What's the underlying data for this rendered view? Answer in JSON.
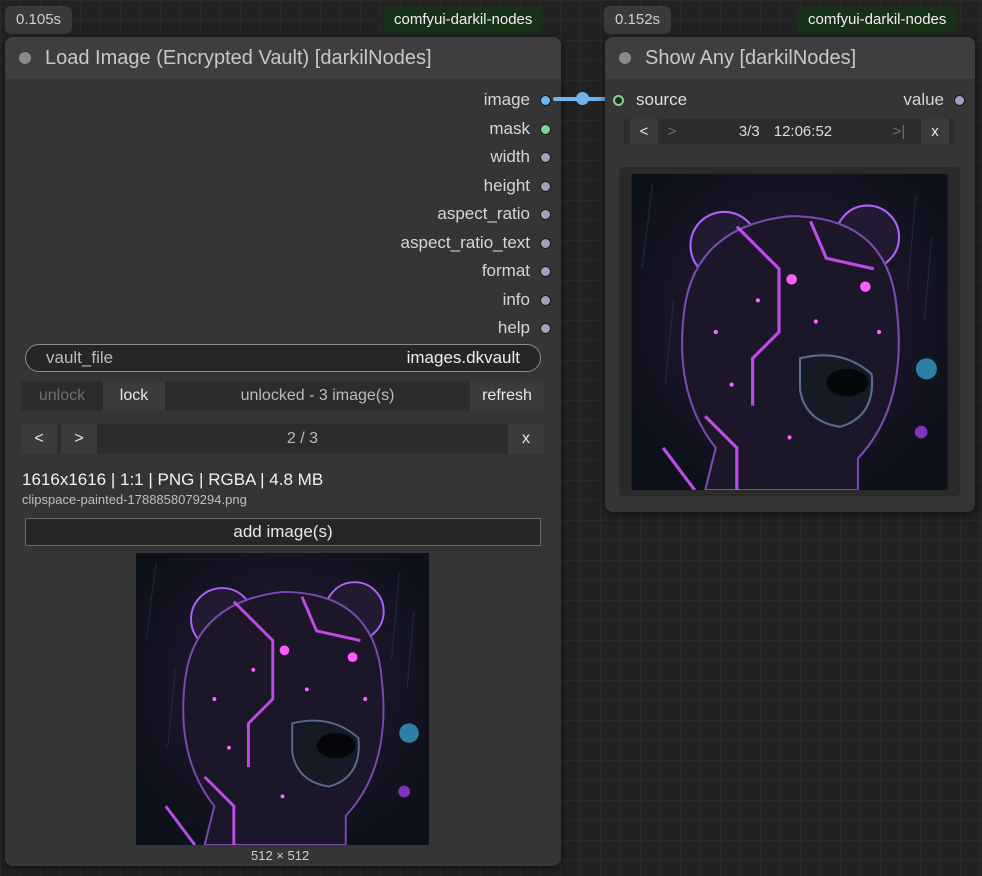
{
  "left_node": {
    "timing": "0.105s",
    "pack": "comfyui-darkil-nodes",
    "title": "Load Image (Encrypted Vault) [darkilNodes]",
    "outputs": [
      {
        "label": "image",
        "color": "#6fb7ea"
      },
      {
        "label": "mask",
        "color": "#7fd68a"
      },
      {
        "label": "width",
        "color": "#a0a0c0"
      },
      {
        "label": "height",
        "color": "#a0a0c0"
      },
      {
        "label": "aspect_ratio",
        "color": "#a0a0c0"
      },
      {
        "label": "aspect_ratio_text",
        "color": "#a0a0c0"
      },
      {
        "label": "format",
        "color": "#a0a0c0"
      },
      {
        "label": "info",
        "color": "#a0a0c0"
      },
      {
        "label": "help",
        "color": "#a0a0c0"
      }
    ],
    "vault_file": {
      "label": "vault_file",
      "value": "images.dkvault"
    },
    "unlock_label": "unlock",
    "lock_label": "lock",
    "status": "unlocked - 3 image(s)",
    "refresh_label": "refresh",
    "prev_label": "<",
    "next_label": ">",
    "page": "2 / 3",
    "close_label": "x",
    "meta": "1616x1616 | 1:1 | PNG | RGBA | 4.8 MB",
    "filename": "clipspace-painted-1788858079294.png",
    "add_label": "add image(s)",
    "preview_size": "512 × 512"
  },
  "right_node": {
    "timing": "0.152s",
    "pack": "comfyui-darkil-nodes",
    "title": "Show Any [darkilNodes]",
    "input_label": "source",
    "output_label": "value",
    "nav": {
      "prev": "<",
      "next": ">",
      "counter": "3/3",
      "time": "12:06:52",
      "last": ">|",
      "close": "x"
    }
  },
  "colors": {
    "image_link": "#6fb7ea",
    "mask_slot": "#7fd68a",
    "neon": "#c040ff",
    "bear_bg": "#0d1119"
  }
}
